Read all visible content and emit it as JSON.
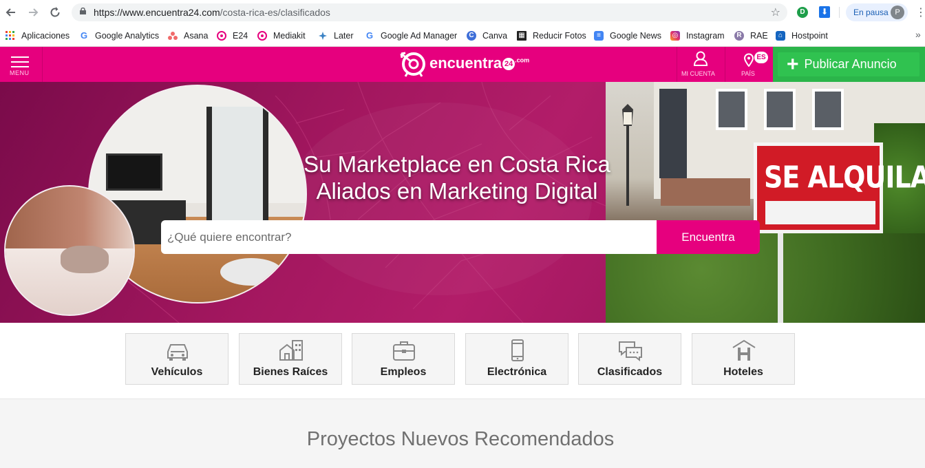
{
  "browser": {
    "url_host": "https://www.encuentra24.com",
    "url_path": "/costa-rica-es/clasificados",
    "pause_label": "En pausa",
    "profile_initial": "P",
    "bookmarks": [
      {
        "label": "Aplicaciones",
        "icon": "apps-grid-icon"
      },
      {
        "label": "Google Analytics",
        "icon": "google-icon"
      },
      {
        "label": "Asana",
        "icon": "asana-icon"
      },
      {
        "label": "E24",
        "icon": "e24-icon"
      },
      {
        "label": "Mediakit",
        "icon": "e24-icon"
      },
      {
        "label": "Later",
        "icon": "later-icon"
      },
      {
        "label": "Google Ad Manager",
        "icon": "google-icon"
      },
      {
        "label": "Canva",
        "icon": "canva-icon"
      },
      {
        "label": "Reducir Fotos",
        "icon": "photo-icon"
      },
      {
        "label": "Google News",
        "icon": "google-news-icon"
      },
      {
        "label": "Instagram",
        "icon": "instagram-icon"
      },
      {
        "label": "RAE",
        "icon": "rae-icon"
      },
      {
        "label": "Hostpoint",
        "icon": "hostpoint-icon"
      }
    ]
  },
  "header": {
    "menu_label": "MENU",
    "logo_text": "encuentra",
    "logo_number": "24",
    "logo_suffix": ".com",
    "account_label": "MI CUENTA",
    "country_label": "PAÍS",
    "country_code": "ES",
    "publish_label": "Publicar Anuncio"
  },
  "hero": {
    "title_line1": "Su Marketplace en Costa Rica",
    "title_line2": "Aliados en Marketing Digital",
    "search_placeholder": "¿Qué quiere encontrar?",
    "search_button": "Encuentra",
    "sign_text": "SE ALQUILA"
  },
  "categories": [
    {
      "label": "Vehículos",
      "icon": "car-icon"
    },
    {
      "label": "Bienes Raíces",
      "icon": "house-icon"
    },
    {
      "label": "Empleos",
      "icon": "briefcase-icon"
    },
    {
      "label": "Electrónica",
      "icon": "phone-icon"
    },
    {
      "label": "Clasificados",
      "icon": "chat-bubbles-icon"
    },
    {
      "label": "Hoteles",
      "icon": "hotel-icon"
    }
  ],
  "section": {
    "title": "Proyectos Nuevos Recomendados"
  },
  "colors": {
    "brand": "#e6007e",
    "publish_green": "#2bb54a",
    "hero_dark": "#7a0b4a"
  }
}
